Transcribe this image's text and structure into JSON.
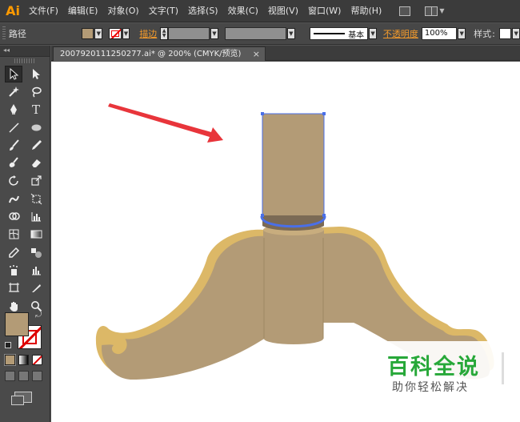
{
  "app": {
    "logo": "Ai"
  },
  "menu": {
    "items": [
      "文件(F)",
      "编辑(E)",
      "对象(O)",
      "文字(T)",
      "选择(S)",
      "效果(C)",
      "视图(V)",
      "窗口(W)",
      "帮助(H)"
    ]
  },
  "control_bar": {
    "selection_type": "路径",
    "stroke_link": "描边",
    "stroke_profile": "基本",
    "opacity_link": "不透明度",
    "opacity_value": "100%",
    "style_label": "样式"
  },
  "tool_panel": {
    "collapse_glyph": "◂◂"
  },
  "document": {
    "tab_title": "2007920111250277.ai* @ 200% (CMYK/预览)",
    "close_glyph": "×"
  },
  "colors": {
    "fill": "#b39b76",
    "table_edge": "#dcb867",
    "selection": "#4a6fe8",
    "arrow": "#e8353b",
    "watermark_green": "#27a839"
  },
  "watermark": {
    "title": "百科全说",
    "subtitle": "助你轻松解决"
  }
}
